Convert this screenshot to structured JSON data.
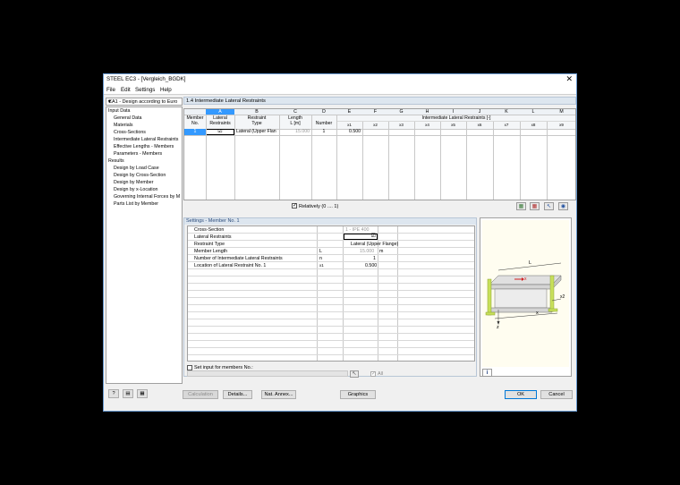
{
  "window": {
    "title": "STEEL EC3 - [Vergleich_BGDK]",
    "close": "✕"
  },
  "menu": [
    "File",
    "Edit",
    "Settings",
    "Help"
  ],
  "case_selector": {
    "value": "CA1 - Design according to Euro",
    "arrow": "▾"
  },
  "nav": {
    "input_header": "Input Data",
    "input_items": [
      "General Data",
      "Materials",
      "Cross-Sections",
      "Intermediate Lateral Restraints",
      "Effective Lengths - Members",
      "Parameters - Members"
    ],
    "results_header": "Results",
    "results_items": [
      "Design by Load Case",
      "Design by Cross-Section",
      "Design by Member",
      "Design by x-Location",
      "Governing Internal Forces by M",
      "Parts List by Member"
    ]
  },
  "section_title": "1.4 Intermediate Lateral Restraints",
  "table": {
    "col_letters": [
      "A",
      "B",
      "C",
      "D",
      "E",
      "F",
      "G",
      "H",
      "I",
      "J",
      "K",
      "L",
      "M"
    ],
    "member_no_header": "Member\nNo.",
    "headers": {
      "lateral_restraints": "Lateral\nRestraints",
      "restraint_type": "Restraint\nType",
      "length": "Length\nL [m]",
      "number": "Number",
      "intermediate": "Intermediate Lateral Restraints [-]"
    },
    "x_headers": [
      "x1",
      "x2",
      "x3",
      "x4",
      "x5",
      "x6",
      "x7",
      "x8",
      "x9"
    ],
    "rows": [
      {
        "member": "1",
        "lateral": "☑",
        "type": "Lateral (Upper Flan",
        "length": "15.000",
        "number": "1",
        "x1": "0.500"
      }
    ]
  },
  "relatively_label": "Relatively (0 .... 1)",
  "settings": {
    "title": "Settings - Member No. 1",
    "rows": [
      {
        "label": "Cross-Section",
        "symbol": "",
        "value": "1 - IPE 400",
        "unit": ""
      },
      {
        "label": "Lateral Restraints",
        "symbol": "",
        "value": "☑",
        "unit": ""
      },
      {
        "label": "Restraint Type",
        "symbol": "",
        "value": "Lateral (Upper Flange)",
        "unit": ""
      },
      {
        "label": "Member Length",
        "symbol": "L",
        "value": "15.000",
        "unit": "m"
      },
      {
        "label": "Number of Intermediate Lateral Restraints",
        "symbol": "n",
        "value": "1",
        "unit": ""
      },
      {
        "label": "Location of Lateral Restraint No. 1",
        "symbol": "x1",
        "value": "0.500",
        "unit": ""
      }
    ],
    "set_input_label": "Set input for members No.:",
    "all_label": "All"
  },
  "preview_labels": {
    "L": "L",
    "x": "x",
    "xi": "x",
    "z": "z",
    "x2": "x2"
  },
  "buttons": {
    "calculation": "Calculation",
    "details": "Details...",
    "nat_annex": "Nat. Annex...",
    "graphics": "Graphics",
    "ok": "OK",
    "cancel": "Cancel"
  },
  "colors": {
    "accent": "#0078d7",
    "header_blue": "#dde6ef",
    "selected_row": "#3399ff",
    "beam_yellow": "#c8e05a"
  }
}
